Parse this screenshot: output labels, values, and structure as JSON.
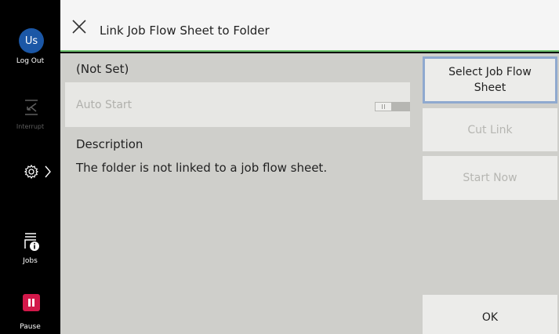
{
  "sidebar": {
    "avatar_text": "Us",
    "logout_label": "Log Out",
    "interrupt_label": "Interrupt",
    "jobs_label": "Jobs",
    "pause_label": "Pause",
    "pause_color": "#d2184a",
    "avatar_color": "#1b57a6"
  },
  "header": {
    "title": "Link Job Flow Sheet to Folder",
    "accent_color": "#6ec46e"
  },
  "main": {
    "current_value": "(Not Set)",
    "auto_start_label": "Auto Start",
    "auto_start_on": false,
    "description_heading": "Description",
    "description_text": "The folder is not linked to a job flow sheet."
  },
  "actions": {
    "select_label": "Select Job Flow Sheet",
    "cut_label": "Cut Link",
    "start_label": "Start Now",
    "ok_label": "OK"
  }
}
